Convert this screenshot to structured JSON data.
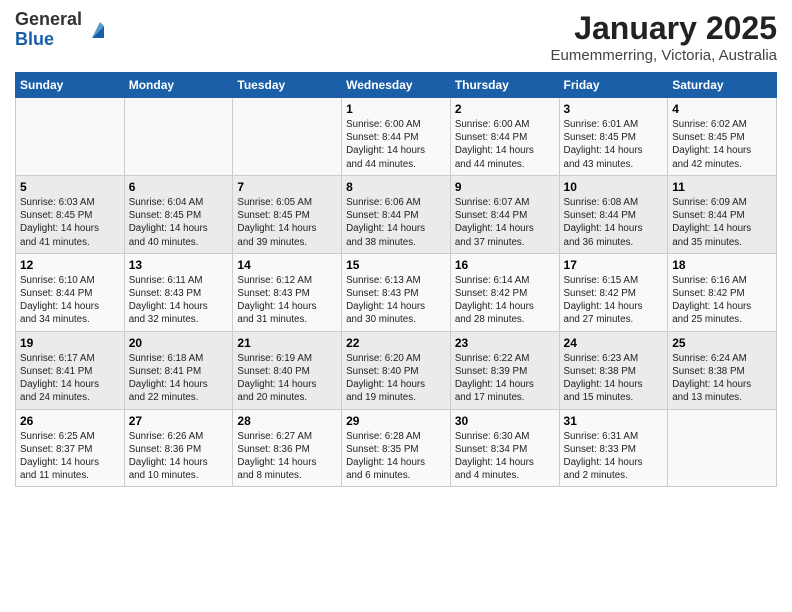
{
  "header": {
    "logo_general": "General",
    "logo_blue": "Blue",
    "title": "January 2025",
    "subtitle": "Eumemmerring, Victoria, Australia"
  },
  "weekdays": [
    "Sunday",
    "Monday",
    "Tuesday",
    "Wednesday",
    "Thursday",
    "Friday",
    "Saturday"
  ],
  "weeks": [
    [
      {
        "day": "",
        "info": ""
      },
      {
        "day": "",
        "info": ""
      },
      {
        "day": "",
        "info": ""
      },
      {
        "day": "1",
        "info": "Sunrise: 6:00 AM\nSunset: 8:44 PM\nDaylight: 14 hours\nand 44 minutes."
      },
      {
        "day": "2",
        "info": "Sunrise: 6:00 AM\nSunset: 8:44 PM\nDaylight: 14 hours\nand 44 minutes."
      },
      {
        "day": "3",
        "info": "Sunrise: 6:01 AM\nSunset: 8:45 PM\nDaylight: 14 hours\nand 43 minutes."
      },
      {
        "day": "4",
        "info": "Sunrise: 6:02 AM\nSunset: 8:45 PM\nDaylight: 14 hours\nand 42 minutes."
      }
    ],
    [
      {
        "day": "5",
        "info": "Sunrise: 6:03 AM\nSunset: 8:45 PM\nDaylight: 14 hours\nand 41 minutes."
      },
      {
        "day": "6",
        "info": "Sunrise: 6:04 AM\nSunset: 8:45 PM\nDaylight: 14 hours\nand 40 minutes."
      },
      {
        "day": "7",
        "info": "Sunrise: 6:05 AM\nSunset: 8:45 PM\nDaylight: 14 hours\nand 39 minutes."
      },
      {
        "day": "8",
        "info": "Sunrise: 6:06 AM\nSunset: 8:44 PM\nDaylight: 14 hours\nand 38 minutes."
      },
      {
        "day": "9",
        "info": "Sunrise: 6:07 AM\nSunset: 8:44 PM\nDaylight: 14 hours\nand 37 minutes."
      },
      {
        "day": "10",
        "info": "Sunrise: 6:08 AM\nSunset: 8:44 PM\nDaylight: 14 hours\nand 36 minutes."
      },
      {
        "day": "11",
        "info": "Sunrise: 6:09 AM\nSunset: 8:44 PM\nDaylight: 14 hours\nand 35 minutes."
      }
    ],
    [
      {
        "day": "12",
        "info": "Sunrise: 6:10 AM\nSunset: 8:44 PM\nDaylight: 14 hours\nand 34 minutes."
      },
      {
        "day": "13",
        "info": "Sunrise: 6:11 AM\nSunset: 8:43 PM\nDaylight: 14 hours\nand 32 minutes."
      },
      {
        "day": "14",
        "info": "Sunrise: 6:12 AM\nSunset: 8:43 PM\nDaylight: 14 hours\nand 31 minutes."
      },
      {
        "day": "15",
        "info": "Sunrise: 6:13 AM\nSunset: 8:43 PM\nDaylight: 14 hours\nand 30 minutes."
      },
      {
        "day": "16",
        "info": "Sunrise: 6:14 AM\nSunset: 8:42 PM\nDaylight: 14 hours\nand 28 minutes."
      },
      {
        "day": "17",
        "info": "Sunrise: 6:15 AM\nSunset: 8:42 PM\nDaylight: 14 hours\nand 27 minutes."
      },
      {
        "day": "18",
        "info": "Sunrise: 6:16 AM\nSunset: 8:42 PM\nDaylight: 14 hours\nand 25 minutes."
      }
    ],
    [
      {
        "day": "19",
        "info": "Sunrise: 6:17 AM\nSunset: 8:41 PM\nDaylight: 14 hours\nand 24 minutes."
      },
      {
        "day": "20",
        "info": "Sunrise: 6:18 AM\nSunset: 8:41 PM\nDaylight: 14 hours\nand 22 minutes."
      },
      {
        "day": "21",
        "info": "Sunrise: 6:19 AM\nSunset: 8:40 PM\nDaylight: 14 hours\nand 20 minutes."
      },
      {
        "day": "22",
        "info": "Sunrise: 6:20 AM\nSunset: 8:40 PM\nDaylight: 14 hours\nand 19 minutes."
      },
      {
        "day": "23",
        "info": "Sunrise: 6:22 AM\nSunset: 8:39 PM\nDaylight: 14 hours\nand 17 minutes."
      },
      {
        "day": "24",
        "info": "Sunrise: 6:23 AM\nSunset: 8:38 PM\nDaylight: 14 hours\nand 15 minutes."
      },
      {
        "day": "25",
        "info": "Sunrise: 6:24 AM\nSunset: 8:38 PM\nDaylight: 14 hours\nand 13 minutes."
      }
    ],
    [
      {
        "day": "26",
        "info": "Sunrise: 6:25 AM\nSunset: 8:37 PM\nDaylight: 14 hours\nand 11 minutes."
      },
      {
        "day": "27",
        "info": "Sunrise: 6:26 AM\nSunset: 8:36 PM\nDaylight: 14 hours\nand 10 minutes."
      },
      {
        "day": "28",
        "info": "Sunrise: 6:27 AM\nSunset: 8:36 PM\nDaylight: 14 hours\nand 8 minutes."
      },
      {
        "day": "29",
        "info": "Sunrise: 6:28 AM\nSunset: 8:35 PM\nDaylight: 14 hours\nand 6 minutes."
      },
      {
        "day": "30",
        "info": "Sunrise: 6:30 AM\nSunset: 8:34 PM\nDaylight: 14 hours\nand 4 minutes."
      },
      {
        "day": "31",
        "info": "Sunrise: 6:31 AM\nSunset: 8:33 PM\nDaylight: 14 hours\nand 2 minutes."
      },
      {
        "day": "",
        "info": ""
      }
    ]
  ]
}
